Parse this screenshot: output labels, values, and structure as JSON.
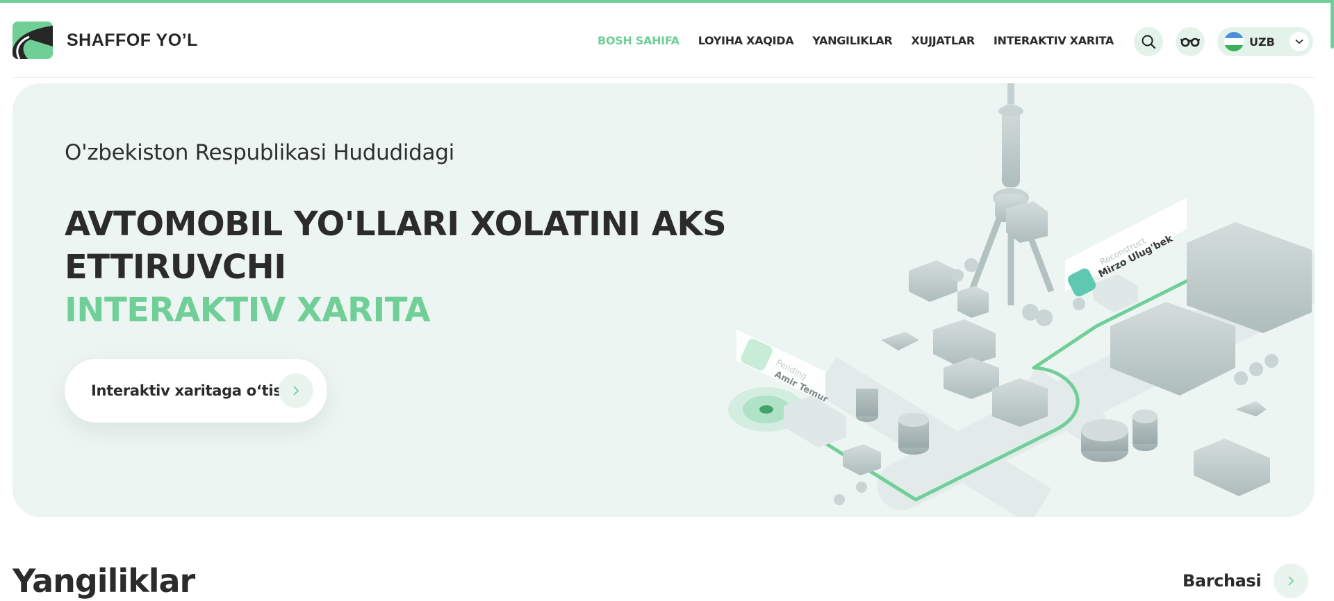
{
  "brand": {
    "name": "SHAFFOF YO’L",
    "accent": "#6fcf97",
    "logo_icon": "road-logo-icon"
  },
  "nav": {
    "items": [
      {
        "label": "BOSH SAHIFA",
        "active": true
      },
      {
        "label": "LOYIHA XAQIDA",
        "active": false
      },
      {
        "label": "YANGILIKLAR",
        "active": false
      },
      {
        "label": "XUJJATLAR",
        "active": false
      },
      {
        "label": "INTERAKTIV XARITA",
        "active": false
      }
    ]
  },
  "header_actions": {
    "search_icon": "search-icon",
    "accessibility_icon": "glasses-icon",
    "language": {
      "label": "UZB",
      "flag": "uzbekistan-flag-icon"
    }
  },
  "hero": {
    "subtitle": "O'zbekiston Respublikasi Hududidagi",
    "title_line1": "AVTOMOBIL YO'LLARI XOLATINI AKS",
    "title_line2": "ETTIRUVCHI",
    "title_highlight": "INTERAKTIV XARITA",
    "cta_label": "Interaktiv xaritaga o‘tish",
    "map_badges": [
      {
        "status": "Reconstruct",
        "street": "Mirzo Ulug'bek"
      },
      {
        "status": "Pending",
        "street": "Amir Temur"
      }
    ]
  },
  "news": {
    "title": "Yangiliklar",
    "see_all_label": "Barchasi"
  }
}
